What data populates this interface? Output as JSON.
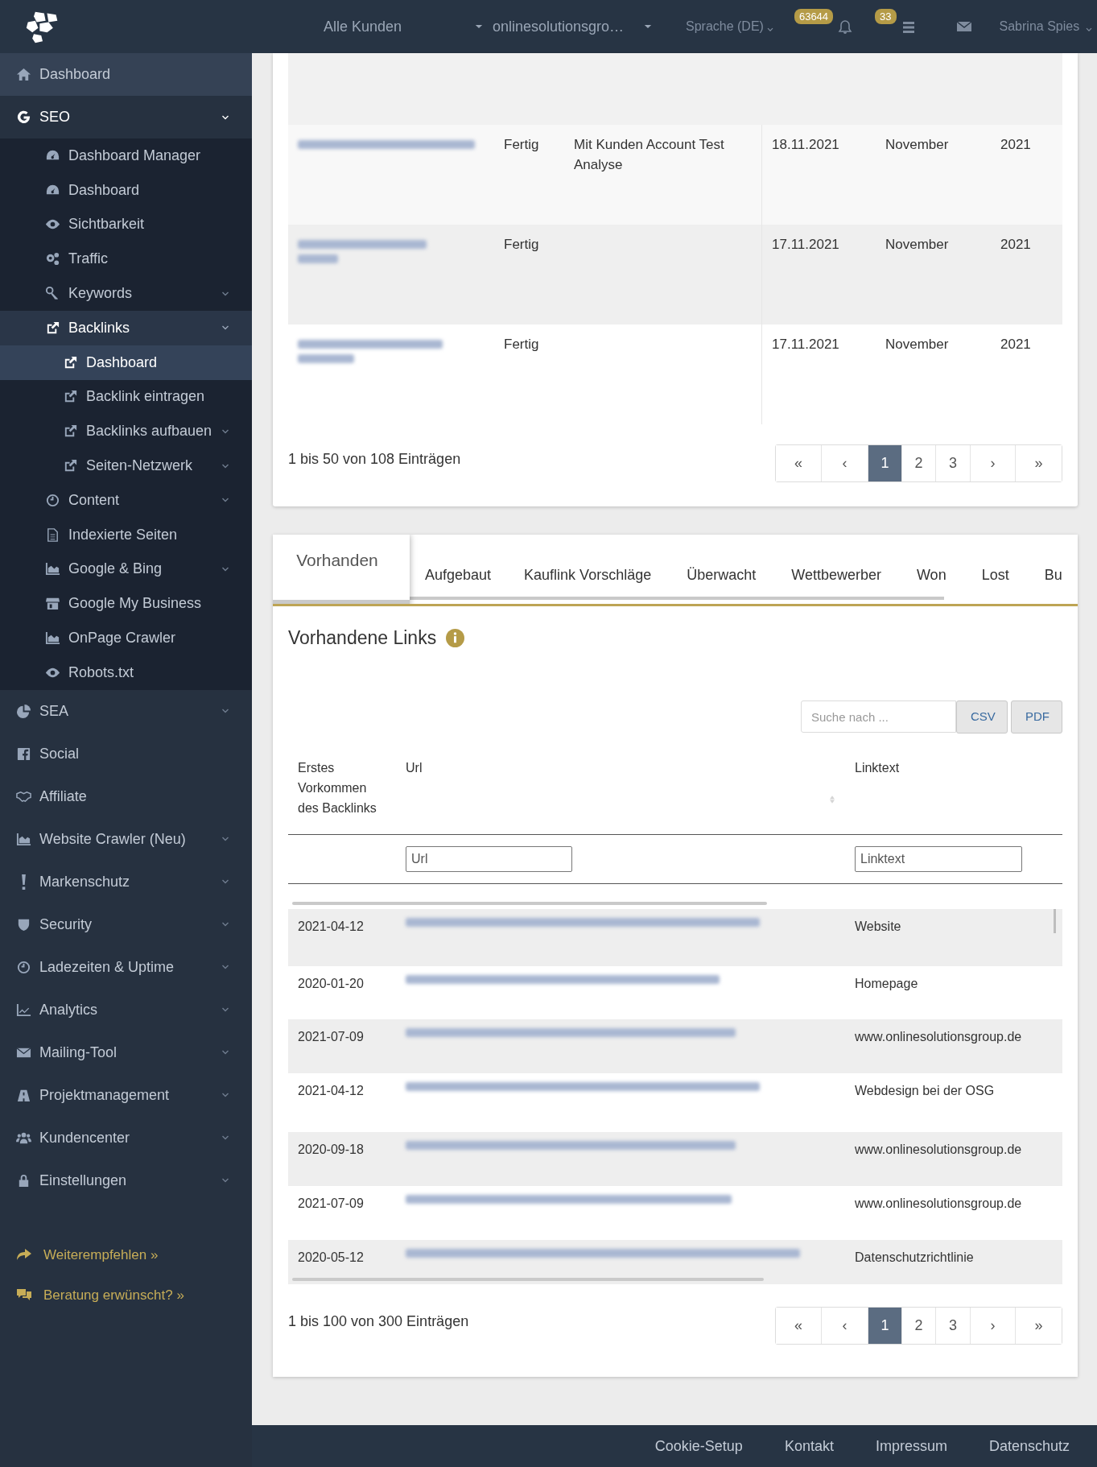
{
  "topbar": {
    "customer_select": "Alle Kunden",
    "project_select": "onlinesolutionsgro…",
    "language": "Sprache (DE)",
    "notification_count": "63644",
    "task_count": "33",
    "user": "Sabrina Spies"
  },
  "sidebar": {
    "items": [
      {
        "label": "Dashboard",
        "hover": true,
        "selected": false
      },
      {
        "label": "SEO",
        "hover": false,
        "selected": false,
        "expanded": true,
        "children": [
          {
            "label": "Dashboard Manager",
            "selected": false
          },
          {
            "label": "Dashboard",
            "selected": false
          },
          {
            "label": "Sichtbarkeit",
            "selected": false
          },
          {
            "label": "Traffic",
            "selected": false
          },
          {
            "label": "Keywords",
            "selected": false,
            "expanded": false
          },
          {
            "label": "Backlinks",
            "selected": false,
            "expanded": true,
            "children": [
              {
                "label": "Dashboard",
                "selected": true
              },
              {
                "label": "Backlink eintragen",
                "selected": false
              },
              {
                "label": "Backlinks aufbauen",
                "selected": false,
                "expanded": false
              },
              {
                "label": "Seiten-Netzwerk",
                "selected": false,
                "expanded": false
              }
            ]
          },
          {
            "label": "Content",
            "selected": false,
            "expanded": false
          },
          {
            "label": "Indexierte Seiten",
            "selected": false
          },
          {
            "label": "Google & Bing",
            "selected": false,
            "expanded": false
          },
          {
            "label": "Google My Business",
            "selected": false
          },
          {
            "label": "OnPage Crawler",
            "selected": false
          },
          {
            "label": "Robots.txt",
            "selected": false
          }
        ]
      },
      {
        "label": "SEA",
        "hover": false,
        "selected": false,
        "expanded": false
      },
      {
        "label": "Social",
        "hover": false,
        "selected": false
      },
      {
        "label": "Affiliate",
        "hover": false,
        "selected": false
      },
      {
        "label": "Website Crawler (Neu)",
        "hover": false,
        "selected": false,
        "expanded": false
      },
      {
        "label": "Markenschutz",
        "hover": false,
        "selected": false,
        "expanded": false
      },
      {
        "label": "Security",
        "hover": false,
        "selected": false,
        "expanded": false
      },
      {
        "label": "Ladezeiten & Uptime",
        "hover": false,
        "selected": false,
        "expanded": false
      },
      {
        "label": "Analytics",
        "hover": false,
        "selected": false,
        "expanded": false
      },
      {
        "label": "Mailing-Tool",
        "hover": false,
        "selected": false,
        "expanded": false
      },
      {
        "label": "Projektmanagement",
        "hover": false,
        "selected": false,
        "expanded": false
      },
      {
        "label": "Kundencenter",
        "hover": false,
        "selected": false,
        "expanded": false
      },
      {
        "label": "Einstellungen",
        "hover": false,
        "selected": false,
        "expanded": false
      }
    ],
    "promo_links": [
      "Weiterempfehlen »",
      "Beratung erwünscht? »"
    ]
  },
  "analysis_table": {
    "rows": [
      {
        "status": "Fertig",
        "description": "Mit Kunden Account Test Analyse",
        "date": "18.11.2021",
        "month": "November",
        "year": "2021"
      },
      {
        "status": "Fertig",
        "date": "17.11.2021",
        "month": "November",
        "year": "2021"
      },
      {
        "status": "Fertig",
        "date": "17.11.2021",
        "month": "November",
        "year": "2021"
      }
    ],
    "summary": "1 bis 50 von 108 Einträgen",
    "pagination": [
      {
        "label": "«",
        "selected": false
      },
      {
        "label": "‹",
        "selected": false
      },
      {
        "label": "1",
        "selected": true
      },
      {
        "label": "2",
        "selected": false
      },
      {
        "label": "3",
        "selected": false
      },
      {
        "label": "›",
        "selected": false
      },
      {
        "label": "»",
        "selected": false
      }
    ]
  },
  "tabs": [
    {
      "label": "Vorhanden",
      "selected": true
    },
    {
      "label": "Aufgebaut",
      "selected": false
    },
    {
      "label": "Kauflink Vorschläge",
      "selected": false
    },
    {
      "label": "Überwacht",
      "selected": false
    },
    {
      "label": "Wettbewerber",
      "selected": false
    },
    {
      "label": "Won",
      "selected": false
    },
    {
      "label": "Lost",
      "selected": false
    },
    {
      "label": "Bu",
      "selected": false
    }
  ],
  "links_panel": {
    "title": "Vorhandene Links",
    "search": {
      "placeholder": "Suche nach ..."
    },
    "export_buttons": [
      "CSV",
      "PDF"
    ],
    "columns": [
      "Erstes Vorkommen des Backlinks",
      "Url",
      "Linktext"
    ],
    "filters": [
      {
        "placeholder": "Url"
      },
      {
        "placeholder": "Linktext"
      }
    ],
    "rows": [
      {
        "date": "2021-04-12",
        "linktext": "Website"
      },
      {
        "date": "2020-01-20",
        "linktext": "Homepage"
      },
      {
        "date": "2021-07-09",
        "linktext": "www.onlinesolutionsgroup.de"
      },
      {
        "date": "2021-04-12",
        "linktext": "Webdesign bei der OSG"
      },
      {
        "date": "2020-09-18",
        "linktext": "www.onlinesolutionsgroup.de"
      },
      {
        "date": "2021-07-09",
        "linktext": "www.onlinesolutionsgroup.de"
      },
      {
        "date": "2020-05-12",
        "linktext": "Datenschutzrichtlinie"
      }
    ],
    "summary": "1 bis 100 von 300 Einträgen",
    "pagination": [
      {
        "label": "«",
        "selected": false
      },
      {
        "label": "‹",
        "selected": false
      },
      {
        "label": "1",
        "selected": true
      },
      {
        "label": "2",
        "selected": false
      },
      {
        "label": "3",
        "selected": false
      },
      {
        "label": "›",
        "selected": false
      },
      {
        "label": "»",
        "selected": false
      }
    ]
  },
  "footer": {
    "links": [
      "Cookie-Setup",
      "Kontakt",
      "Impressum",
      "Datenschutz"
    ]
  }
}
